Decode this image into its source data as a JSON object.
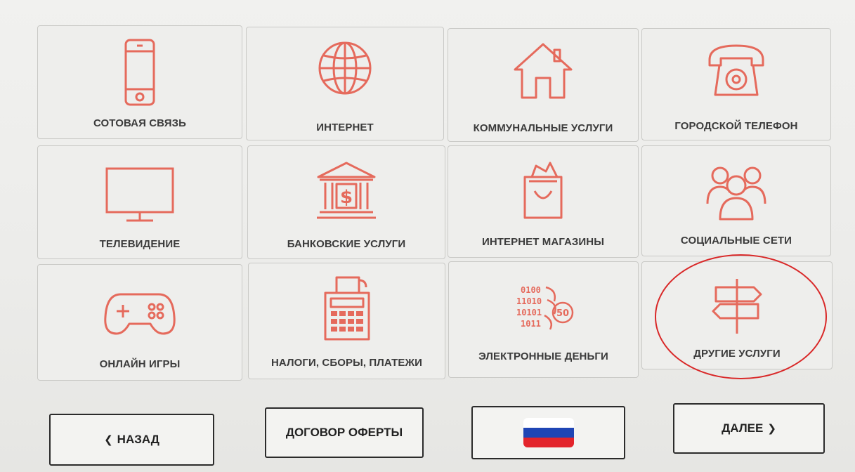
{
  "tiles": [
    {
      "label": "СОТОВАЯ СВЯЗЬ",
      "icon": "mobile-phone-icon"
    },
    {
      "label": "ИНТЕРНЕТ",
      "icon": "globe-icon"
    },
    {
      "label": "КОММУНАЛЬНЫЕ УСЛУГИ",
      "icon": "house-icon"
    },
    {
      "label": "ГОРОДСКОЙ ТЕЛЕФОН",
      "icon": "landline-phone-icon"
    },
    {
      "label": "ТЕЛЕВИДЕНИЕ",
      "icon": "tv-icon"
    },
    {
      "label": "БАНКОВСКИЕ УСЛУГИ",
      "icon": "bank-icon"
    },
    {
      "label": "ИНТЕРНЕТ МАГАЗИНЫ",
      "icon": "shopping-bag-icon"
    },
    {
      "label": "СОЦИАЛЬНЫЕ СЕТИ",
      "icon": "people-icon"
    },
    {
      "label": "ОНЛАЙН ИГРЫ",
      "icon": "gamepad-icon"
    },
    {
      "label": "НАЛОГИ, СБОРЫ, ПЛАТЕЖИ",
      "icon": "calculator-icon"
    },
    {
      "label": "ЭЛЕКТРОННЫЕ ДЕНЬГИ",
      "icon": "digital-money-icon",
      "icon_text": {
        "line1": "0100",
        "line2": "11010",
        "line3": "10101",
        "line4": "1011",
        "coin": "50"
      }
    },
    {
      "label": "ДРУГИЕ УСЛУГИ",
      "icon": "signpost-icon"
    }
  ],
  "nav": {
    "back_label": "НАЗАД",
    "back_icon": "chevron-left-icon",
    "offer_label": "ДОГОВОР ОФЕРТЫ",
    "language_icon": "russian-flag-icon",
    "next_label": "ДАЛЕЕ",
    "next_icon": "chevron-right-icon"
  },
  "colors": {
    "accent": "#e56a5c",
    "highlight_circle": "#d92828",
    "flag_white": "#ffffff",
    "flag_blue": "#1f45b5",
    "flag_red": "#e3242b"
  }
}
